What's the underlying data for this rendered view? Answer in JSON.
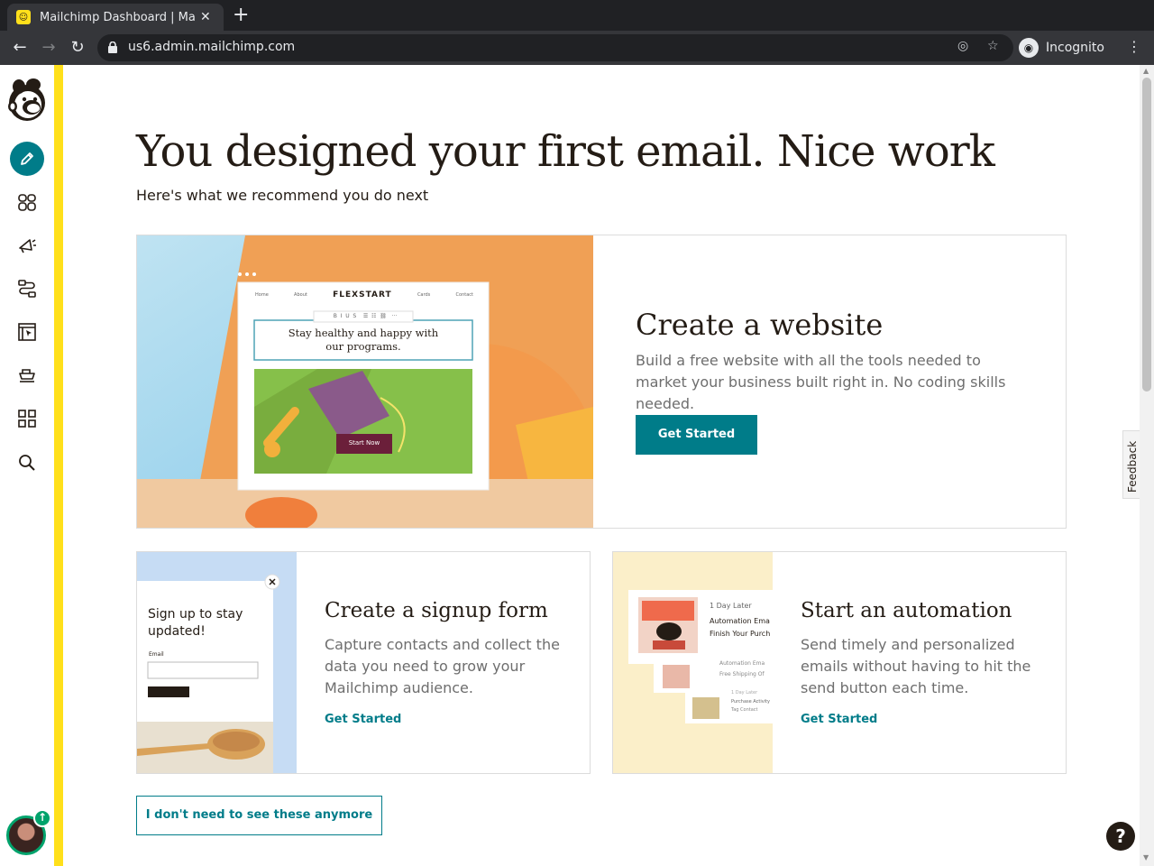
{
  "browser": {
    "tab_title": "Mailchimp Dashboard | Ma",
    "url": "us6.admin.mailchimp.com",
    "profile_label": "Incognito"
  },
  "sidenav": {
    "items": [
      "create-icon",
      "audience-icon",
      "campaigns-icon",
      "automations-icon",
      "website-icon",
      "content-icon",
      "integrations-icon",
      "search-icon"
    ]
  },
  "main": {
    "title": "You designed your first email. Nice work",
    "subtitle": "Here's what we recommend you do next"
  },
  "website_card": {
    "title": "Create a website",
    "text": "Build a free website with all the tools needed to market your business built right in. No coding skills needed.",
    "button": "Get Started",
    "preview": {
      "nav": [
        "Home",
        "About",
        "Cards",
        "Contact"
      ],
      "brand": "FLEXSTART",
      "toolbar": "B  I  U  S    ☰  ☷  ⛓   ···",
      "headline": "Stay healthy and happy with our programs.",
      "cta": "Start Now"
    }
  },
  "signup_card": {
    "title": "Create a signup form",
    "text": "Capture contacts and collect the data you need to grow your Mailchimp audience.",
    "link": "Get Started",
    "preview": {
      "heading": "Sign up to stay updated!",
      "field_label": "Email"
    }
  },
  "automation_card": {
    "title": "Start an automation",
    "text": "Send timely and personalized emails without having to hit the send button each time.",
    "link": "Get Started",
    "preview": {
      "delay": "1 Day Later",
      "email_title": "Automation Ema",
      "email_sub": "Finish Your Purch",
      "second_title": "Automation Ema",
      "second_sub": "Free Shipping Of",
      "third_pre": "1 Day Later",
      "third_title": "Purchase Activity",
      "third_sub": "Tag Contact"
    }
  },
  "dismiss_button": "I don't need to see these anymore",
  "feedback_label": "Feedback",
  "help_label": "?",
  "colors": {
    "accent": "#007c89",
    "brand_yellow": "#ffe01b",
    "text": "#241c15"
  }
}
